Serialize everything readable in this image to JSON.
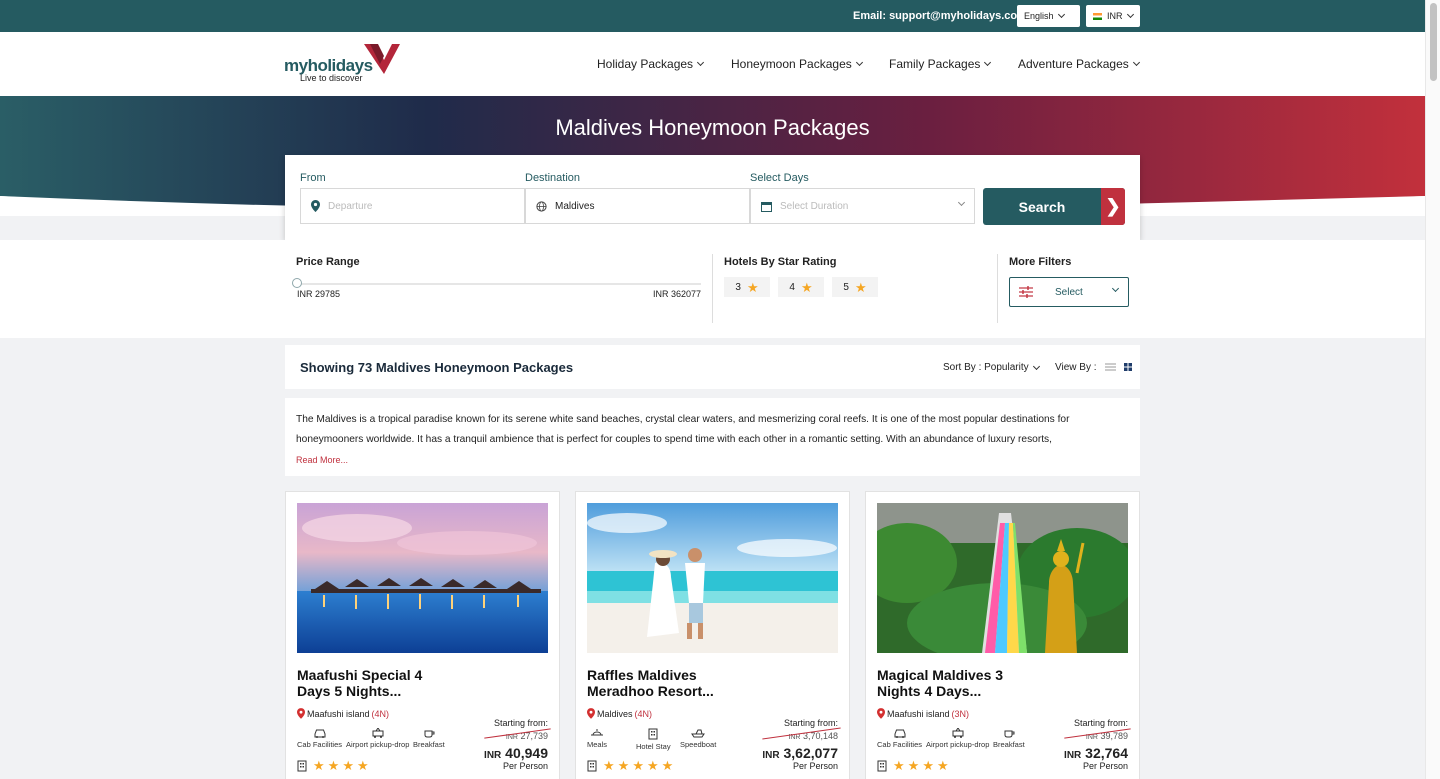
{
  "topbar": {
    "email": "Email: support@myholidays.com",
    "language": "English",
    "currency": "INR"
  },
  "brand": {
    "name": "myholidays",
    "tagline": "Live to discover"
  },
  "nav": [
    {
      "label": "Holiday Packages"
    },
    {
      "label": "Honeymoon Packages"
    },
    {
      "label": "Family Packages"
    },
    {
      "label": "Adventure Packages"
    }
  ],
  "hero": {
    "title": "Maldives Honeymoon Packages"
  },
  "search": {
    "from_label": "From",
    "from_placeholder": "Departure",
    "destination_label": "Destination",
    "destination_value": "Maldives",
    "days_label": "Select Days",
    "days_placeholder": "Select Duration",
    "button": "Search"
  },
  "filters": {
    "price_title": "Price Range",
    "price_min": "INR 29785",
    "price_max": "INR 362077",
    "stars_title": "Hotels By Star Rating",
    "star_options": [
      "3",
      "4",
      "5"
    ],
    "more_title": "More Filters",
    "more_select": "Select"
  },
  "results": {
    "title": "Showing 73 Maldives Honeymoon Packages",
    "sort_label": "Sort By : Popularity",
    "view_label": "View By :"
  },
  "description": {
    "text": "The Maldives is a tropical paradise known for its serene white sand beaches, crystal clear waters, and mesmerizing coral reefs. It is one of the most popular destinations for honeymooners worldwide. It has a tranquil ambience that is perfect for couples to spend time with each other in a romantic setting. With an abundance of luxury resorts,",
    "read_more": "Read More..."
  },
  "colors": {
    "brand_teal": "#255b61",
    "accent_red": "#c0313e",
    "star_gold": "#f5a623"
  },
  "cards": [
    {
      "title": "Maafushi Special 4 Days 5 Nights...",
      "location": "Maafushi island",
      "nights": "(4N)",
      "amenities": [
        "Cab Facilities",
        "Airport pickup-drop",
        "Breakfast"
      ],
      "stars": 4,
      "starting_from": "Starting from:",
      "old_currency": "INR",
      "old_price": "27,739",
      "currency": "INR",
      "price": "40,949",
      "per_person": "Per Person"
    },
    {
      "title": "Raffles Maldives Meradhoo Resort...",
      "location": "Maldives",
      "nights": "(4N)",
      "amenities": [
        "Meals",
        "Hotel Stay",
        "Speedboat"
      ],
      "stars": 5,
      "starting_from": "Starting from:",
      "old_currency": "INR",
      "old_price": "3,70,148",
      "currency": "INR",
      "price": "3,62,077",
      "per_person": "Per Person"
    },
    {
      "title": "Magical Maldives 3 Nights 4 Days...",
      "location": "Maafushi island",
      "nights": "(3N)",
      "amenities": [
        "Cab Facilities",
        "Airport pickup-drop",
        "Breakfast"
      ],
      "stars": 4,
      "starting_from": "Starting from:",
      "old_currency": "INR",
      "old_price": "39,789",
      "currency": "INR",
      "price": "32,764",
      "per_person": "Per Person"
    }
  ]
}
